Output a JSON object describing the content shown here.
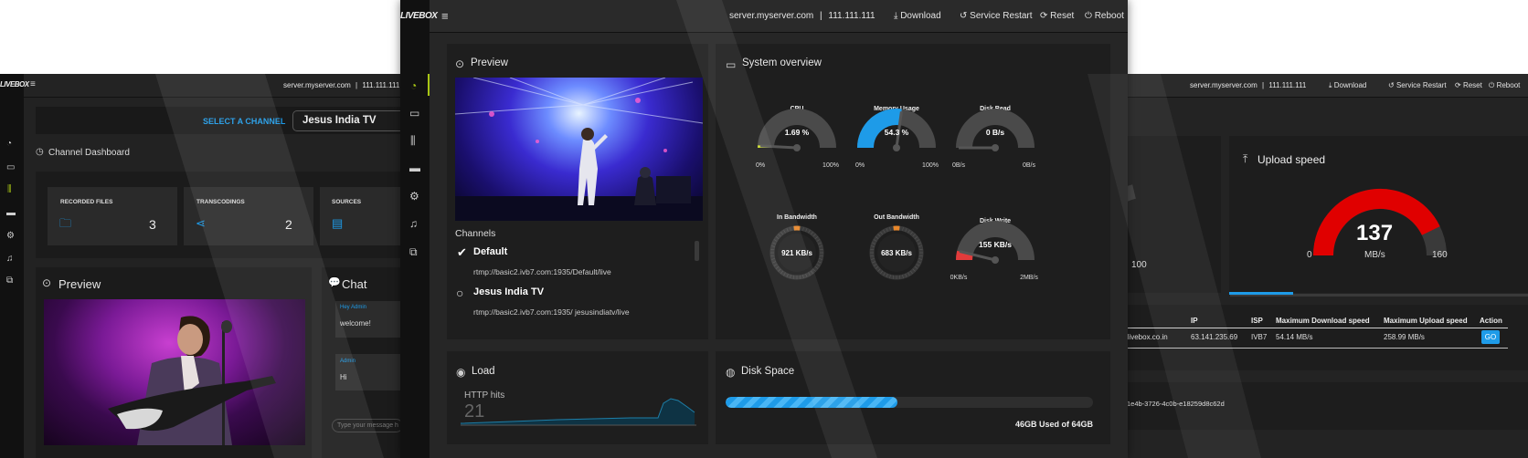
{
  "brand": {
    "logo": "LIVEBOX",
    "server": "server.myserver.com",
    "ip": "111.111.111",
    "sep": "|"
  },
  "actions": {
    "download": "Download",
    "restart": "Service Restart",
    "reset": "Reset",
    "reboot": "Reboot"
  },
  "left": {
    "select_label": "SELECT A CHANNEL",
    "channel": "Jesus India TV",
    "dashboard_title": "Channel Dashboard",
    "stats": [
      {
        "label": "RECORDED FILES",
        "value": "3",
        "icon": "folder-icon"
      },
      {
        "label": "TRANSCODINGS",
        "value": "2",
        "icon": "share-icon"
      },
      {
        "label": "SOURCES",
        "value": "",
        "icon": "document-icon"
      }
    ],
    "preview_title": "Preview",
    "chat_title": "Chat",
    "chat": [
      {
        "user": "Hey Admin",
        "msg": "welcome!"
      },
      {
        "user": "Admin",
        "msg": "Hi"
      }
    ],
    "chat_placeholder": "Type your message h"
  },
  "center": {
    "preview_title": "Preview",
    "channels_title": "Channels",
    "channels": [
      {
        "name": "Default",
        "url": "rtmp://basic2.ivb7.com:1935/Default/live",
        "selected": true
      },
      {
        "name": "Jesus India TV",
        "url": "rtmp://basic2.ivb7.com:1935/ jesusindiatv/live",
        "selected": false
      }
    ],
    "overview_title": "System overview",
    "gauges": [
      {
        "label": "CPU",
        "value": "1.69 %",
        "min": "0%",
        "max": "100%",
        "level": 0.0169,
        "color": "#c8d92a"
      },
      {
        "label": "Memory Usage",
        "value": "54.3 %",
        "min": "0%",
        "max": "100%",
        "level": 0.543,
        "color": "#1e9be8"
      },
      {
        "label": "Disk Read",
        "value": "0 B/s",
        "min": "0B/s",
        "max": "0B/s",
        "level": 0,
        "color": "#888"
      },
      {
        "label": "Disk Write",
        "value": "155 KB/s",
        "min": "0KB/s",
        "max": "2MB/s",
        "level": 0.0757,
        "color": "#e23b3b"
      }
    ],
    "dials": [
      {
        "label": "In Bandwidth",
        "value": "921 KB/s"
      },
      {
        "label": "Out Bandwidth",
        "value": "683 KB/s"
      }
    ],
    "load_title": "Load",
    "http_label": "HTTP hits",
    "http_value": "21",
    "disk_title": "Disk Space",
    "disk_used_text": "46GB Used of 64GB",
    "disk_fraction": 0.46875
  },
  "right": {
    "upload_title": "Upload speed",
    "upload_value": "137",
    "upload_unit": "MB/s",
    "upload_min": "0",
    "upload_max": "160",
    "upload_level": 0.85625,
    "partial_value": "100",
    "table_headers": [
      "IP",
      "ISP",
      "Maximum Download speed",
      "Maximum Upload speed",
      "Action"
    ],
    "row": {
      "host": "h.livebox.co.in",
      "ip": "63.141.235.69",
      "isp": "IVB7",
      "down": "54.14 MB/s",
      "up": "258.99 MB/s",
      "action": "GO"
    },
    "key": "1e4b-3726-4c0b-e18259d8c62d"
  },
  "colors": {
    "accent": "#1e9be8",
    "green": "#a8c614",
    "red": "#e00000",
    "panel": "#1f1f1f",
    "bg": "#232323"
  }
}
